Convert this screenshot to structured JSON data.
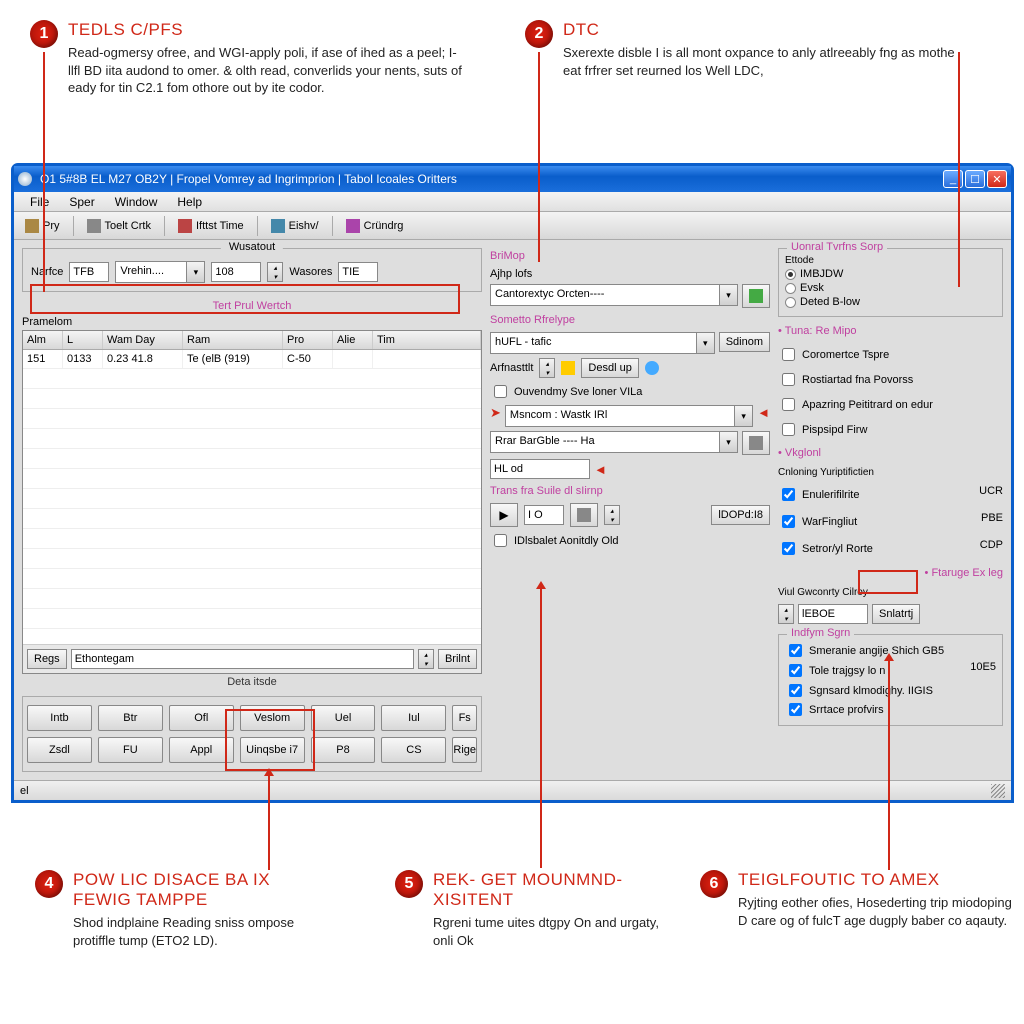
{
  "callouts": {
    "c1": {
      "num": "1",
      "title": "TEDLS C/PFS",
      "body": "Read-ogmersy ofree, and WGI-apply poli, if ase of ihed as a peel; I-llfl BD iita audond to omer. & olth read, converlids your nents, suts of eady for tin C2.1 fom othore out by ite codor."
    },
    "c2": {
      "num": "2",
      "title": "DTC",
      "body": "Sxerexte disble I is all mont oxpance to anly atlreeably fng as mothe eat frfrer set reurned los Well LDC,"
    },
    "c4": {
      "num": "4",
      "title": "POW LIC DISACE BA IX FEWIG TAMPPE",
      "body": "Shod indplaine Reading sniss ompose protiffle tump (ETO2 LD)."
    },
    "c5": {
      "num": "5",
      "title": "REK- GET MOUNMND-XISITENT",
      "body": "Rgreni tume uites dtgpy On and urgaty, onli Ok"
    },
    "c6": {
      "num": "6",
      "title": "TEIGLFOUTIC TO AMEX",
      "body": "Ryjting eother ofies, Hosederting trip miodoping D care og of fulcT age dugply baber co aqauty."
    }
  },
  "window": {
    "title": "O1 5#8B EL M27 OB2Y | Fropel Vomrey ad Ingrimprion | Tabol Icoales Oritters"
  },
  "menu": {
    "file": "File",
    "sper": "Sper",
    "window": "Window",
    "help": "Help"
  },
  "toolbar": {
    "b1": "Pry",
    "b2": "Toelt Crtk",
    "b3": "Ifttst Time",
    "b4": "Eishv/",
    "b5": "Cründrg"
  },
  "left": {
    "tab": "Wusatout",
    "topbar": {
      "l1": "Narfce",
      "v1": "TFB",
      "l2": "Vrehin....",
      "v2": "",
      "v3": "108",
      "l3": "Wasores",
      "v3b": "TIE"
    },
    "pinklbl": "Tert Prul Wertch",
    "tablename": "Pramelom",
    "cols": [
      "Alm",
      "L",
      "Wam Day",
      "Ram",
      "Pro",
      "Alie",
      "Tim"
    ],
    "row1": [
      "151",
      "0133",
      "0.23 41.8",
      "Te (elB (919)",
      "C-50",
      "",
      ""
    ],
    "foot_btn": "Regs",
    "foot_text": "Ethontegam",
    "foot_btn2": "Brilnt",
    "dota": "Deta itsde",
    "buttons": [
      "Intb",
      "Btr",
      "Ofl",
      "Veslom",
      "Uel",
      "Iul",
      "Fs",
      "Zsdl",
      "FU",
      "Appl",
      "Uinqsbe i7",
      "P8",
      "CS",
      "Rige"
    ]
  },
  "middle": {
    "lbl1": "BriMop",
    "lbl2": "Ajhp lofs",
    "dd1": "Cantorextyc Orcten----",
    "lbl3": "Sometto Rfrelype",
    "dd2": "hUFL - tafic",
    "dd2b": "Sdinom",
    "lbl4": "Arfnasttlt",
    "btn1": "Desdl up",
    "chk1": "Ouvendmy Sve loner VILa",
    "dd3": "Msncom : Wastk IRl",
    "dd4": "Rrar BarGble ---- Ha",
    "tf1": "HL od",
    "lbl5": "Trans fra Suile dl sIirnp",
    "tf2": "I O",
    "btn2": "lDOPd:I8",
    "chk2": "IDlsbalet Aonitdly Old"
  },
  "right": {
    "box1_title": "Uonral Tvrfns Sorp",
    "box1_lbl": "Ettode",
    "box1_opts": [
      "IMBJDW",
      "Evsk",
      "Deted B-low"
    ],
    "hdr1": "Tuna: Re Mipo",
    "chk_a": "Coromertce Tspre",
    "chk_b": "Rostiartad fna Povorss",
    "chk_c": "Apazring Peititrard on edur",
    "chk_d": "Pispsipd Firw",
    "hdr2": "Vkglonl",
    "subhdr": "Cnloning Yuriptifictien",
    "kv1_k": "Enulerifilrite",
    "kv1_v": "UCR",
    "kv2_k": "WarFingliut",
    "kv2_v": "PBE",
    "kv3_k": "Setror/yl Rorte",
    "kv3_v": "CDP",
    "hdr3": "Ftaruge Ex leg",
    "hdr4": "Viul Gwconrty Cilroy",
    "tf3": "lEBOE",
    "btn3": "Snlatrtj",
    "box2_title": "Indfym Sgrn",
    "box2_c1": "Smeranie angije Shich GB5",
    "box2_c2": "Tole trajgsy lo n",
    "box2_c2v": "10E5",
    "box2_c3": "Sgnsard klmodighy. IIGIS",
    "box2_c4": "Srrtace profvirs"
  },
  "status": "el"
}
